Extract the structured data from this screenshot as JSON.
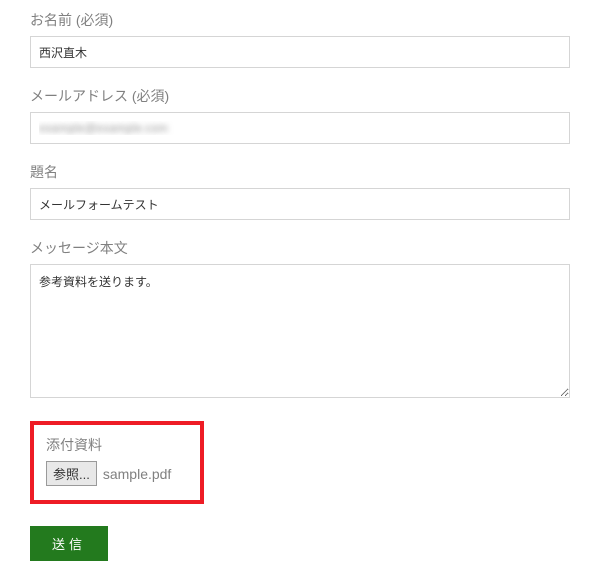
{
  "form": {
    "name": {
      "label": "お名前 (必須)",
      "value": "西沢直木"
    },
    "email": {
      "label": "メールアドレス (必須)",
      "value": "example@example.com"
    },
    "subject": {
      "label": "題名",
      "value": "メールフォームテスト"
    },
    "message": {
      "label": "メッセージ本文",
      "value": "参考資料を送ります。"
    },
    "attachment": {
      "label": "添付資料",
      "browse_label": "参照...",
      "file_name": "sample.pdf"
    },
    "submit_label": "送信"
  }
}
